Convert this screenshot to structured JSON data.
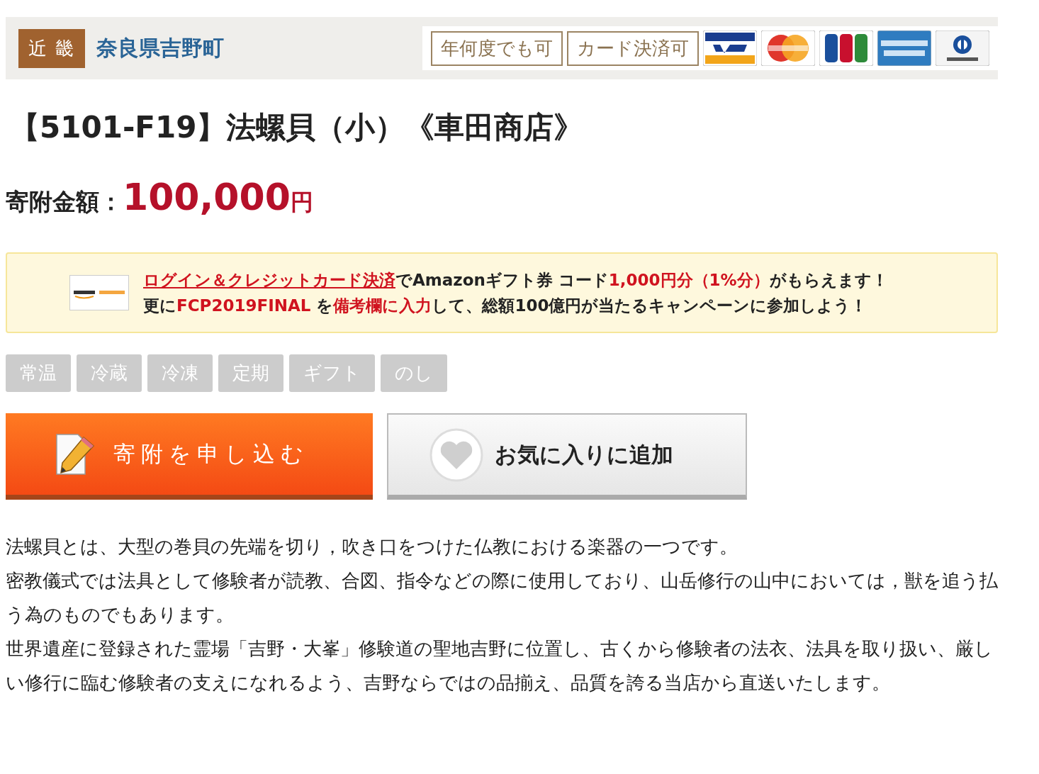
{
  "header": {
    "region": "近 畿",
    "town": "奈良県吉野町",
    "badges": [
      "年何度でも可",
      "カード決済可"
    ],
    "cards": [
      {
        "kind": "visa"
      },
      {
        "kind": "master"
      },
      {
        "kind": "jcb"
      },
      {
        "kind": "amex"
      },
      {
        "kind": "diners"
      }
    ]
  },
  "title": "【5101-F19】法螺貝（小）《車田商店》",
  "price": {
    "label": "寄附金額：",
    "amount": "100,000",
    "unit": "円"
  },
  "promo": {
    "lines": [
      [
        {
          "kind": "link",
          "text": "ログイン＆クレジットカード決済"
        },
        {
          "kind": "plain",
          "text": "でAmazonギフト券 コード"
        },
        {
          "kind": "highlight",
          "text": "1,000円分（1%分）"
        },
        {
          "kind": "plain",
          "text": "がもらえます！"
        }
      ],
      [
        {
          "kind": "plain",
          "text": "更に"
        },
        {
          "kind": "highlight",
          "text": "FCP2019FINAL"
        },
        {
          "kind": "plain",
          "text": " を"
        },
        {
          "kind": "highlight",
          "text": "備考欄に入力"
        },
        {
          "kind": "plain",
          "text": "して、総額100億円が当たるキャンペーンに参加しよう！"
        }
      ]
    ]
  },
  "tags": [
    {
      "label": "常温",
      "active": false
    },
    {
      "label": "冷蔵",
      "active": false
    },
    {
      "label": "冷凍",
      "active": false
    },
    {
      "label": "定期",
      "active": false
    },
    {
      "label": "ギフト",
      "active": false
    },
    {
      "label": "のし",
      "active": false
    }
  ],
  "buttons": {
    "apply": "寄附を申し込む",
    "favorite": "お気に入りに追加"
  },
  "description": [
    "法螺貝とは、大型の巻貝の先端を切り，吹き口をつけた仏教における楽器の一つです。",
    "密教儀式では法具として修験者が読教、合図、指令などの際に使用しており、山岳修行の山中においては，獣を追う払う為のものでもあります。",
    "世界遺産に登録された霊場「吉野・大峯」修験道の聖地吉野に位置し、古くから修験者の法衣、法具を取り扱い、厳しい修行に臨む修験者の支えになれるよう、吉野ならではの品揃え、品質を誇る当店から直送いたします。"
  ]
}
